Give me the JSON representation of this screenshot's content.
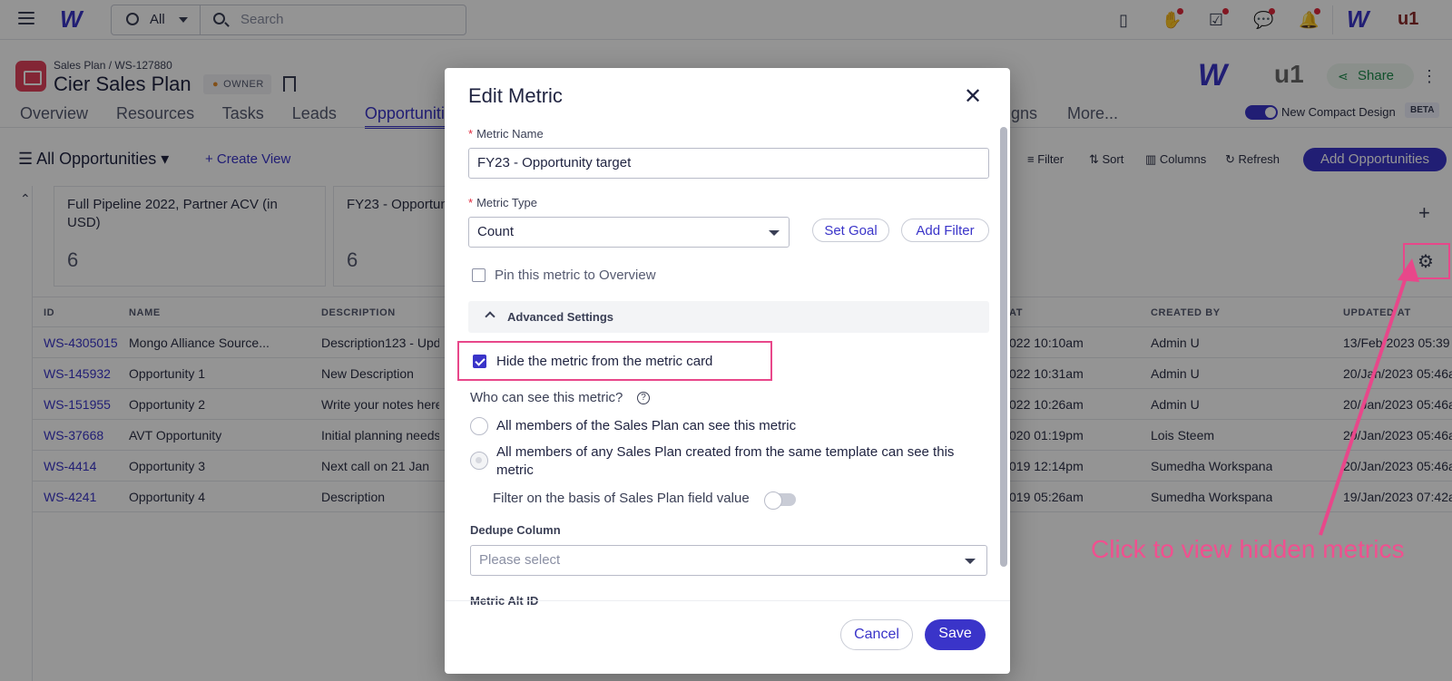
{
  "topbar": {
    "scope": "All",
    "search_placeholder": "Search",
    "brand_right": "u1"
  },
  "header": {
    "breadcrumb": "Sales Plan / WS-127880",
    "title": "Cier Sales Plan",
    "owner_badge": "OWNER",
    "brand_right": "u1",
    "share": "Share",
    "compact_label": "New Compact Design",
    "beta": "BETA"
  },
  "tabs": [
    "Overview",
    "Resources",
    "Tasks",
    "Leads",
    "Opportunities",
    "Campaigns",
    "More..."
  ],
  "toolbar": {
    "view": "All Opportunities",
    "create_view": "+ Create View",
    "filter": "Filter",
    "sort": "Sort",
    "columns": "Columns",
    "refresh": "Refresh",
    "add": "Add Opportunities"
  },
  "metric_cards": [
    {
      "title": "Full Pipeline 2022, Partner ACV (in USD)",
      "value": "6"
    },
    {
      "title": "FY23 - Opportun",
      "value": "6"
    }
  ],
  "table": {
    "headers": [
      "ID",
      "NAME",
      "DESCRIPTION",
      "AT",
      "CREATED BY",
      "UPDATED AT"
    ],
    "rows": [
      {
        "id": "WS-4305015",
        "name": "Mongo Alliance Source...",
        "desc": "Description123 - Upd",
        "at": "022 10:10am",
        "by": "Admin U",
        "upd": "13/Feb/2023 05:39"
      },
      {
        "id": "WS-145932",
        "name": "Opportunity 1",
        "desc": "New Description",
        "at": "022 10:31am",
        "by": "Admin U",
        "upd": "20/Jan/2023 05:46a"
      },
      {
        "id": "WS-151955",
        "name": "Opportunity 2",
        "desc": "Write your notes here",
        "at": "022 10:26am",
        "by": "Admin U",
        "upd": "20/Jan/2023 05:46a"
      },
      {
        "id": "WS-37668",
        "name": "AVT Opportunity",
        "desc": "Initial planning needs",
        "at": "020 01:19pm",
        "by": "Lois Steem",
        "upd": "20/Jan/2023 05:46a"
      },
      {
        "id": "WS-4414",
        "name": "Opportunity 3",
        "desc": "Next call on 21 Jan",
        "at": "019 12:14pm",
        "by": "Sumedha Workspana",
        "upd": "20/Jan/2023 05:46a"
      },
      {
        "id": "WS-4241",
        "name": "Opportunity 4",
        "desc": "Description",
        "at": "019 05:26am",
        "by": "Sumedha Workspana",
        "upd": "19/Jan/2023 07:42a"
      }
    ]
  },
  "annotation": "Click to view hidden metrics",
  "modal": {
    "title": "Edit Metric",
    "metric_name_label": "Metric Name",
    "metric_name_value": "FY23 - Opportunity target",
    "metric_type_label": "Metric Type",
    "metric_type_value": "Count",
    "set_goal": "Set Goal",
    "add_filter": "Add Filter",
    "pin_label": "Pin this metric to Overview",
    "advanced": "Advanced Settings",
    "hide_label": "Hide the metric from the metric card",
    "who_label": "Who can see this metric?",
    "radio1": "All members of the Sales Plan can see this metric",
    "radio2_line1": "All members of any Sales Plan created from the same template can see this",
    "radio2_line2": "metric",
    "filter_label": "Filter on the basis of Sales Plan field value",
    "dedupe_label": "Dedupe Column",
    "dedupe_placeholder": "Please select",
    "alt_id_label": "Metric Alt ID",
    "cancel": "Cancel",
    "save": "Save"
  }
}
